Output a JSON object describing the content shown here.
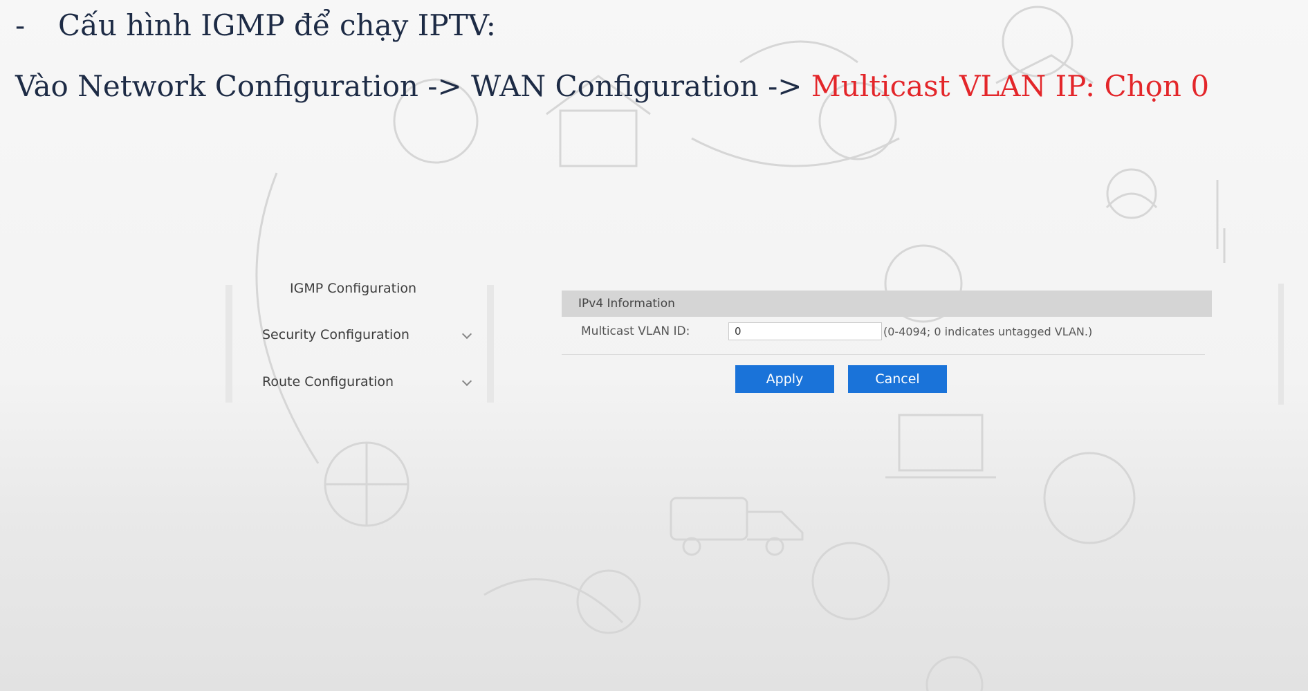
{
  "slide": {
    "bullet": "-",
    "heading": "Cấu hình IGMP để chạy IPTV:",
    "path_prefix": "Vào Network Configuration -> WAN Configuration -> ",
    "path_highlight": "Multicast VLAN IP: Chọn 0",
    "highlight_color": "#e3262a"
  },
  "router_ui": {
    "sidebar": {
      "items": [
        {
          "label": "IGMP Configuration",
          "icon": "none"
        },
        {
          "label": "Security Configuration",
          "icon": "chevron-down-icon"
        },
        {
          "label": "Route Configuration",
          "icon": "chevron-down-icon"
        }
      ]
    },
    "section_title": "IPv4 Information",
    "field": {
      "label": "Multicast VLAN ID:",
      "value": "0",
      "hint": "(0-4094; 0 indicates untagged VLAN.)"
    },
    "buttons": {
      "apply": "Apply",
      "cancel": "Cancel",
      "color": "#1a73d9"
    }
  }
}
